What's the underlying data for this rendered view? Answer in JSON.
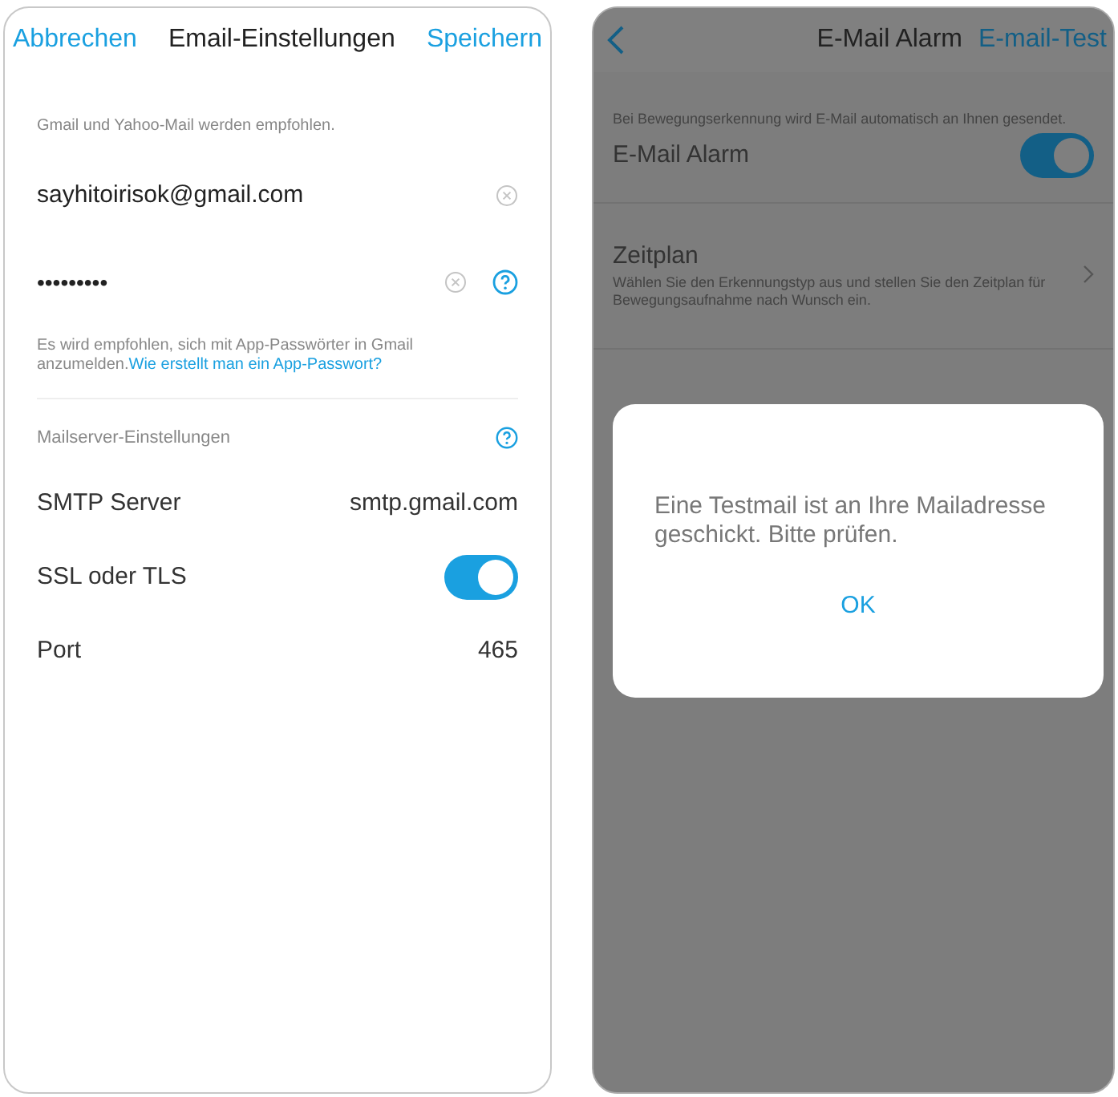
{
  "email_settings": {
    "cancel": "Abbrechen",
    "title": "Email-Einstellungen",
    "save": "Speichern",
    "hint": "Gmail und Yahoo-Mail werden empfohlen.",
    "email": "sayhitoirisok@gmail.com",
    "password": "•••••••••",
    "advice": "Es wird empfohlen, sich mit App-Passwörter in Gmail anzumelden.",
    "advice_link": "Wie erstellt man ein App-Passwort?",
    "server_section": "Mailserver-Einstellungen",
    "rows": [
      {
        "kind": "value",
        "label": "SMTP Server",
        "value": "smtp.gmail.com"
      },
      {
        "kind": "toggle",
        "label": "SSL oder TLS",
        "on": true
      },
      {
        "kind": "value",
        "label": "Port",
        "value": "465"
      }
    ]
  },
  "alarm": {
    "title": "E-Mail Alarm",
    "test": "E-mail-Test",
    "description": "Bei Bewegungserkennung wird E-Mail automatisch an Ihnen gesendet.",
    "toggle_label": "E-Mail Alarm",
    "toggle_on": true,
    "schedule_title": "Zeitplan",
    "schedule_text": "Wählen Sie den Erkennungstyp aus und stellen Sie den Zeitplan für Bewegungsaufnahme nach Wunsch ein."
  },
  "dialog": {
    "message": "Eine Testmail ist an Ihre Mailadresse geschickt. Bitte prüfen.",
    "button": "OK"
  }
}
